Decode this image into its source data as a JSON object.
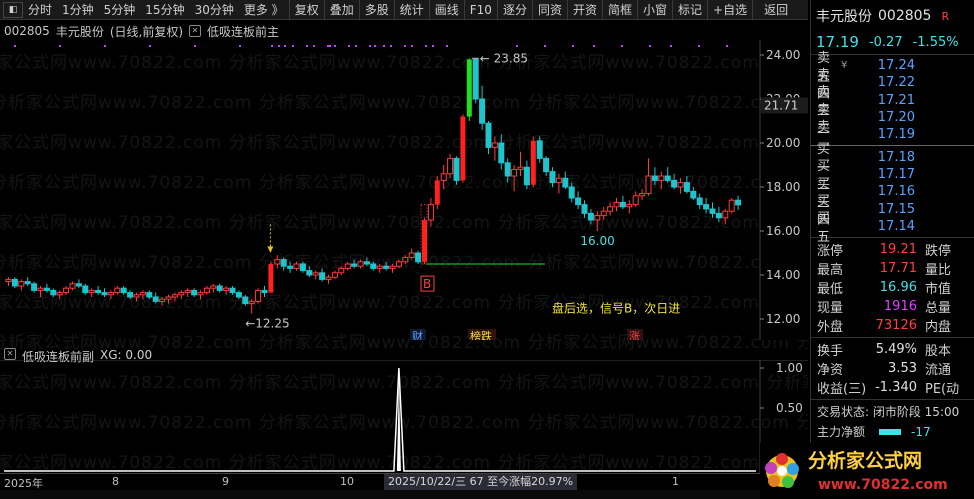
{
  "toolbar": {
    "items": [
      "分时",
      "1分钟",
      "5分钟",
      "15分钟",
      "30分钟",
      "更多 》",
      "复权",
      "叠加",
      "多股",
      "统计",
      "画线",
      "F10",
      "逐分",
      "同资",
      "开资",
      "简框",
      "小窗",
      "标记",
      "+自选",
      "返回"
    ]
  },
  "chart_header": {
    "code": "002805",
    "name": "丰元股份",
    "period": "(日线,前复权)",
    "indicator": "低吸连板前主"
  },
  "main_chart": {
    "price_labels": [
      "24.00",
      "22.00",
      "20.00",
      "18.00",
      "16.00",
      "14.00",
      "12.00"
    ],
    "current_price_tag": "21.71",
    "high_label": "23.85",
    "low_label": "12.25",
    "low2_label": "16.00",
    "signal_letter": "B",
    "signal_text": "盘后选，信号B，次日进",
    "tags": {
      "cai": "财",
      "bang": "榜跌",
      "zhang": "涨"
    }
  },
  "sub_chart": {
    "name": "低吸连板前副",
    "var": "XG: 0.00",
    "scale": [
      "1.00",
      "0.50",
      "0.00"
    ]
  },
  "timeline": {
    "labels": [
      "2025年",
      "8",
      "9",
      "10",
      "1"
    ],
    "cursor": "2025/10/22/三  67  至今涨幅20.97%"
  },
  "watermark": "分析家公式网www.70822.com",
  "panel": {
    "name": "丰元股份",
    "code": "002805",
    "flag": "R",
    "price": "17.19",
    "change": "-0.27",
    "pct": "-1.55%",
    "asks": [
      {
        "label": "卖五",
        "extra": "¥",
        "price": "17.24"
      },
      {
        "label": "卖四",
        "extra": "",
        "price": "17.22"
      },
      {
        "label": "卖三",
        "extra": "",
        "price": "17.21"
      },
      {
        "label": "卖二",
        "extra": "",
        "price": "17.20"
      },
      {
        "label": "卖一",
        "extra": "",
        "price": "17.19"
      }
    ],
    "bids": [
      {
        "label": "买一",
        "price": "17.18"
      },
      {
        "label": "买二",
        "price": "17.17"
      },
      {
        "label": "买三",
        "price": "17.16"
      },
      {
        "label": "买四",
        "price": "17.15"
      },
      {
        "label": "买五",
        "price": "17.14"
      }
    ],
    "stats1": [
      {
        "l": "涨停",
        "v": "19.21",
        "c": "#ff4040",
        "l2": "跌停"
      },
      {
        "l": "最高",
        "v": "17.71",
        "c": "#ff4040",
        "l2": "量比"
      },
      {
        "l": "最低",
        "v": "16.96",
        "c": "#41e0e8",
        "l2": "市值"
      },
      {
        "l": "现量",
        "v": "1916",
        "c": "#e040ff",
        "l2": "总量"
      },
      {
        "l": "外盘",
        "v": "73126",
        "c": "#ff4040",
        "l2": "内盘"
      }
    ],
    "stats2": [
      {
        "l": "换手",
        "v": "5.49%",
        "c": "#e0e0e0",
        "l2": "股本"
      },
      {
        "l": "净资",
        "v": "3.53",
        "c": "#e0e0e0",
        "l2": "流通"
      },
      {
        "l": "收益(三)",
        "v": "-1.340",
        "c": "#e0e0e0",
        "l2": "PE(动"
      }
    ],
    "trade_status": "交易状态: 闭市阶段 15:00",
    "main_flow_label": "主力净额",
    "main_flow_value": "-17"
  },
  "logo": {
    "text": "分析家公式网",
    "url": "www.70822.com"
  },
  "chart_data": {
    "type": "candlestick",
    "ylim": [
      11.5,
      24.5
    ],
    "candles": [
      [
        13.7,
        13.9,
        13.5,
        13.8
      ],
      [
        13.8,
        13.9,
        13.4,
        13.5
      ],
      [
        13.5,
        13.8,
        13.3,
        13.7
      ],
      [
        13.7,
        13.9,
        13.5,
        13.6
      ],
      [
        13.6,
        13.7,
        13.2,
        13.3
      ],
      [
        13.3,
        13.5,
        13.0,
        13.4
      ],
      [
        13.4,
        13.6,
        13.2,
        13.3
      ],
      [
        13.3,
        13.4,
        13.0,
        13.1
      ],
      [
        13.1,
        13.3,
        12.9,
        13.2
      ],
      [
        13.2,
        13.5,
        13.1,
        13.4
      ],
      [
        13.4,
        13.7,
        13.3,
        13.6
      ],
      [
        13.6,
        13.8,
        13.4,
        13.5
      ],
      [
        13.5,
        13.6,
        13.1,
        13.2
      ],
      [
        13.2,
        13.4,
        13.0,
        13.3
      ],
      [
        13.3,
        13.5,
        13.1,
        13.2
      ],
      [
        13.2,
        13.4,
        13.0,
        13.1
      ],
      [
        13.1,
        13.3,
        12.9,
        13.2
      ],
      [
        13.2,
        13.5,
        13.1,
        13.4
      ],
      [
        13.4,
        13.5,
        13.1,
        13.2
      ],
      [
        13.2,
        13.3,
        12.9,
        13.0
      ],
      [
        13.0,
        13.2,
        12.8,
        13.1
      ],
      [
        13.1,
        13.3,
        12.9,
        13.2
      ],
      [
        13.2,
        13.3,
        12.9,
        13.0
      ],
      [
        13.0,
        13.2,
        12.7,
        12.8
      ],
      [
        12.8,
        13.0,
        12.6,
        12.9
      ],
      [
        12.9,
        13.1,
        12.7,
        13.0
      ],
      [
        13.0,
        13.2,
        12.8,
        13.1
      ],
      [
        13.1,
        13.3,
        12.9,
        13.2
      ],
      [
        13.2,
        13.4,
        13.0,
        13.3
      ],
      [
        13.3,
        13.4,
        13.0,
        13.1
      ],
      [
        13.1,
        13.3,
        12.9,
        13.2
      ],
      [
        13.2,
        13.5,
        13.1,
        13.4
      ],
      [
        13.4,
        13.6,
        13.2,
        13.5
      ],
      [
        13.5,
        13.6,
        13.2,
        13.3
      ],
      [
        13.3,
        13.5,
        13.1,
        13.4
      ],
      [
        13.4,
        13.5,
        13.1,
        13.2
      ],
      [
        13.2,
        13.3,
        12.9,
        13.0
      ],
      [
        13.0,
        13.1,
        12.6,
        12.7
      ],
      [
        12.7,
        12.9,
        12.25,
        12.8
      ],
      [
        12.8,
        13.4,
        12.7,
        13.3
      ],
      [
        13.3,
        13.5,
        13.0,
        13.2
      ],
      [
        13.2,
        14.6,
        13.2,
        14.5
      ],
      [
        14.5,
        14.9,
        14.3,
        14.7
      ],
      [
        14.7,
        14.8,
        14.2,
        14.4
      ],
      [
        14.4,
        14.6,
        14.1,
        14.3
      ],
      [
        14.3,
        14.6,
        14.2,
        14.5
      ],
      [
        14.5,
        14.6,
        14.1,
        14.2
      ],
      [
        14.2,
        14.4,
        13.9,
        14.0
      ],
      [
        14.0,
        14.2,
        13.8,
        14.1
      ],
      [
        14.1,
        14.3,
        13.7,
        13.8
      ],
      [
        13.8,
        14.0,
        13.6,
        13.9
      ],
      [
        13.9,
        14.2,
        13.8,
        14.1
      ],
      [
        14.1,
        14.4,
        14.0,
        14.3
      ],
      [
        14.3,
        14.6,
        14.2,
        14.5
      ],
      [
        14.5,
        14.7,
        14.3,
        14.4
      ],
      [
        14.4,
        14.7,
        14.3,
        14.6
      ],
      [
        14.6,
        14.8,
        14.4,
        14.5
      ],
      [
        14.5,
        14.6,
        14.2,
        14.3
      ],
      [
        14.3,
        14.5,
        14.1,
        14.4
      ],
      [
        14.4,
        14.6,
        14.2,
        14.3
      ],
      [
        14.3,
        14.5,
        14.1,
        14.4
      ],
      [
        14.4,
        14.7,
        14.3,
        14.6
      ],
      [
        14.6,
        14.9,
        14.5,
        14.8
      ],
      [
        14.8,
        15.2,
        14.7,
        15.0
      ],
      [
        15.0,
        15.1,
        14.5,
        14.6
      ],
      [
        14.6,
        16.6,
        14.5,
        16.5
      ],
      [
        16.5,
        17.5,
        16.2,
        17.2
      ],
      [
        17.2,
        18.5,
        17.0,
        18.3
      ],
      [
        18.3,
        19.0,
        17.9,
        18.6
      ],
      [
        18.6,
        19.5,
        18.4,
        19.3
      ],
      [
        19.3,
        19.4,
        18.1,
        18.3
      ],
      [
        18.3,
        21.3,
        18.2,
        21.2
      ],
      [
        21.2,
        23.85,
        21.0,
        23.8
      ],
      [
        23.8,
        23.85,
        21.8,
        22.0
      ],
      [
        22.0,
        22.6,
        20.6,
        20.9
      ],
      [
        20.9,
        21.0,
        19.5,
        19.8
      ],
      [
        19.8,
        20.3,
        19.2,
        20.0
      ],
      [
        20.0,
        20.4,
        18.8,
        19.1
      ],
      [
        19.1,
        19.3,
        18.2,
        18.5
      ],
      [
        18.5,
        19.0,
        17.8,
        18.8
      ],
      [
        18.8,
        19.6,
        18.5,
        18.9
      ],
      [
        18.9,
        19.2,
        17.9,
        18.1
      ],
      [
        18.1,
        20.3,
        18.0,
        20.1
      ],
      [
        20.1,
        20.3,
        19.1,
        19.3
      ],
      [
        19.3,
        19.4,
        18.5,
        18.7
      ],
      [
        18.7,
        18.9,
        18.0,
        18.2
      ],
      [
        18.2,
        18.6,
        17.7,
        18.4
      ],
      [
        18.4,
        18.7,
        17.9,
        18.0
      ],
      [
        18.0,
        18.2,
        17.3,
        17.5
      ],
      [
        17.5,
        17.8,
        17.0,
        17.2
      ],
      [
        17.2,
        17.4,
        16.6,
        16.8
      ],
      [
        16.8,
        17.0,
        16.3,
        16.5
      ],
      [
        16.5,
        16.9,
        16.0,
        16.7
      ],
      [
        16.7,
        17.1,
        16.5,
        16.9
      ],
      [
        16.9,
        17.3,
        16.7,
        17.1
      ],
      [
        17.1,
        17.5,
        16.9,
        17.3
      ],
      [
        17.3,
        17.6,
        17.0,
        17.1
      ],
      [
        17.1,
        17.4,
        16.8,
        17.2
      ],
      [
        17.2,
        17.8,
        17.1,
        17.6
      ],
      [
        17.6,
        17.9,
        17.4,
        17.7
      ],
      [
        17.7,
        19.3,
        17.6,
        18.5
      ],
      [
        18.5,
        18.9,
        18.1,
        18.3
      ],
      [
        18.3,
        18.7,
        17.9,
        18.5
      ],
      [
        18.5,
        18.9,
        18.2,
        18.3
      ],
      [
        18.3,
        18.6,
        17.9,
        18.0
      ],
      [
        18.0,
        18.4,
        17.7,
        18.2
      ],
      [
        18.2,
        18.5,
        17.7,
        17.8
      ],
      [
        17.8,
        18.0,
        17.4,
        17.5
      ],
      [
        17.5,
        17.7,
        17.0,
        17.2
      ],
      [
        17.2,
        17.5,
        16.8,
        17.0
      ],
      [
        17.0,
        17.3,
        16.6,
        16.8
      ],
      [
        16.8,
        17.1,
        16.4,
        16.6
      ],
      [
        16.6,
        17.0,
        16.3,
        16.9
      ],
      [
        16.9,
        17.5,
        16.8,
        17.4
      ],
      [
        17.4,
        17.6,
        16.96,
        17.19
      ]
    ],
    "spike_index": 61
  }
}
